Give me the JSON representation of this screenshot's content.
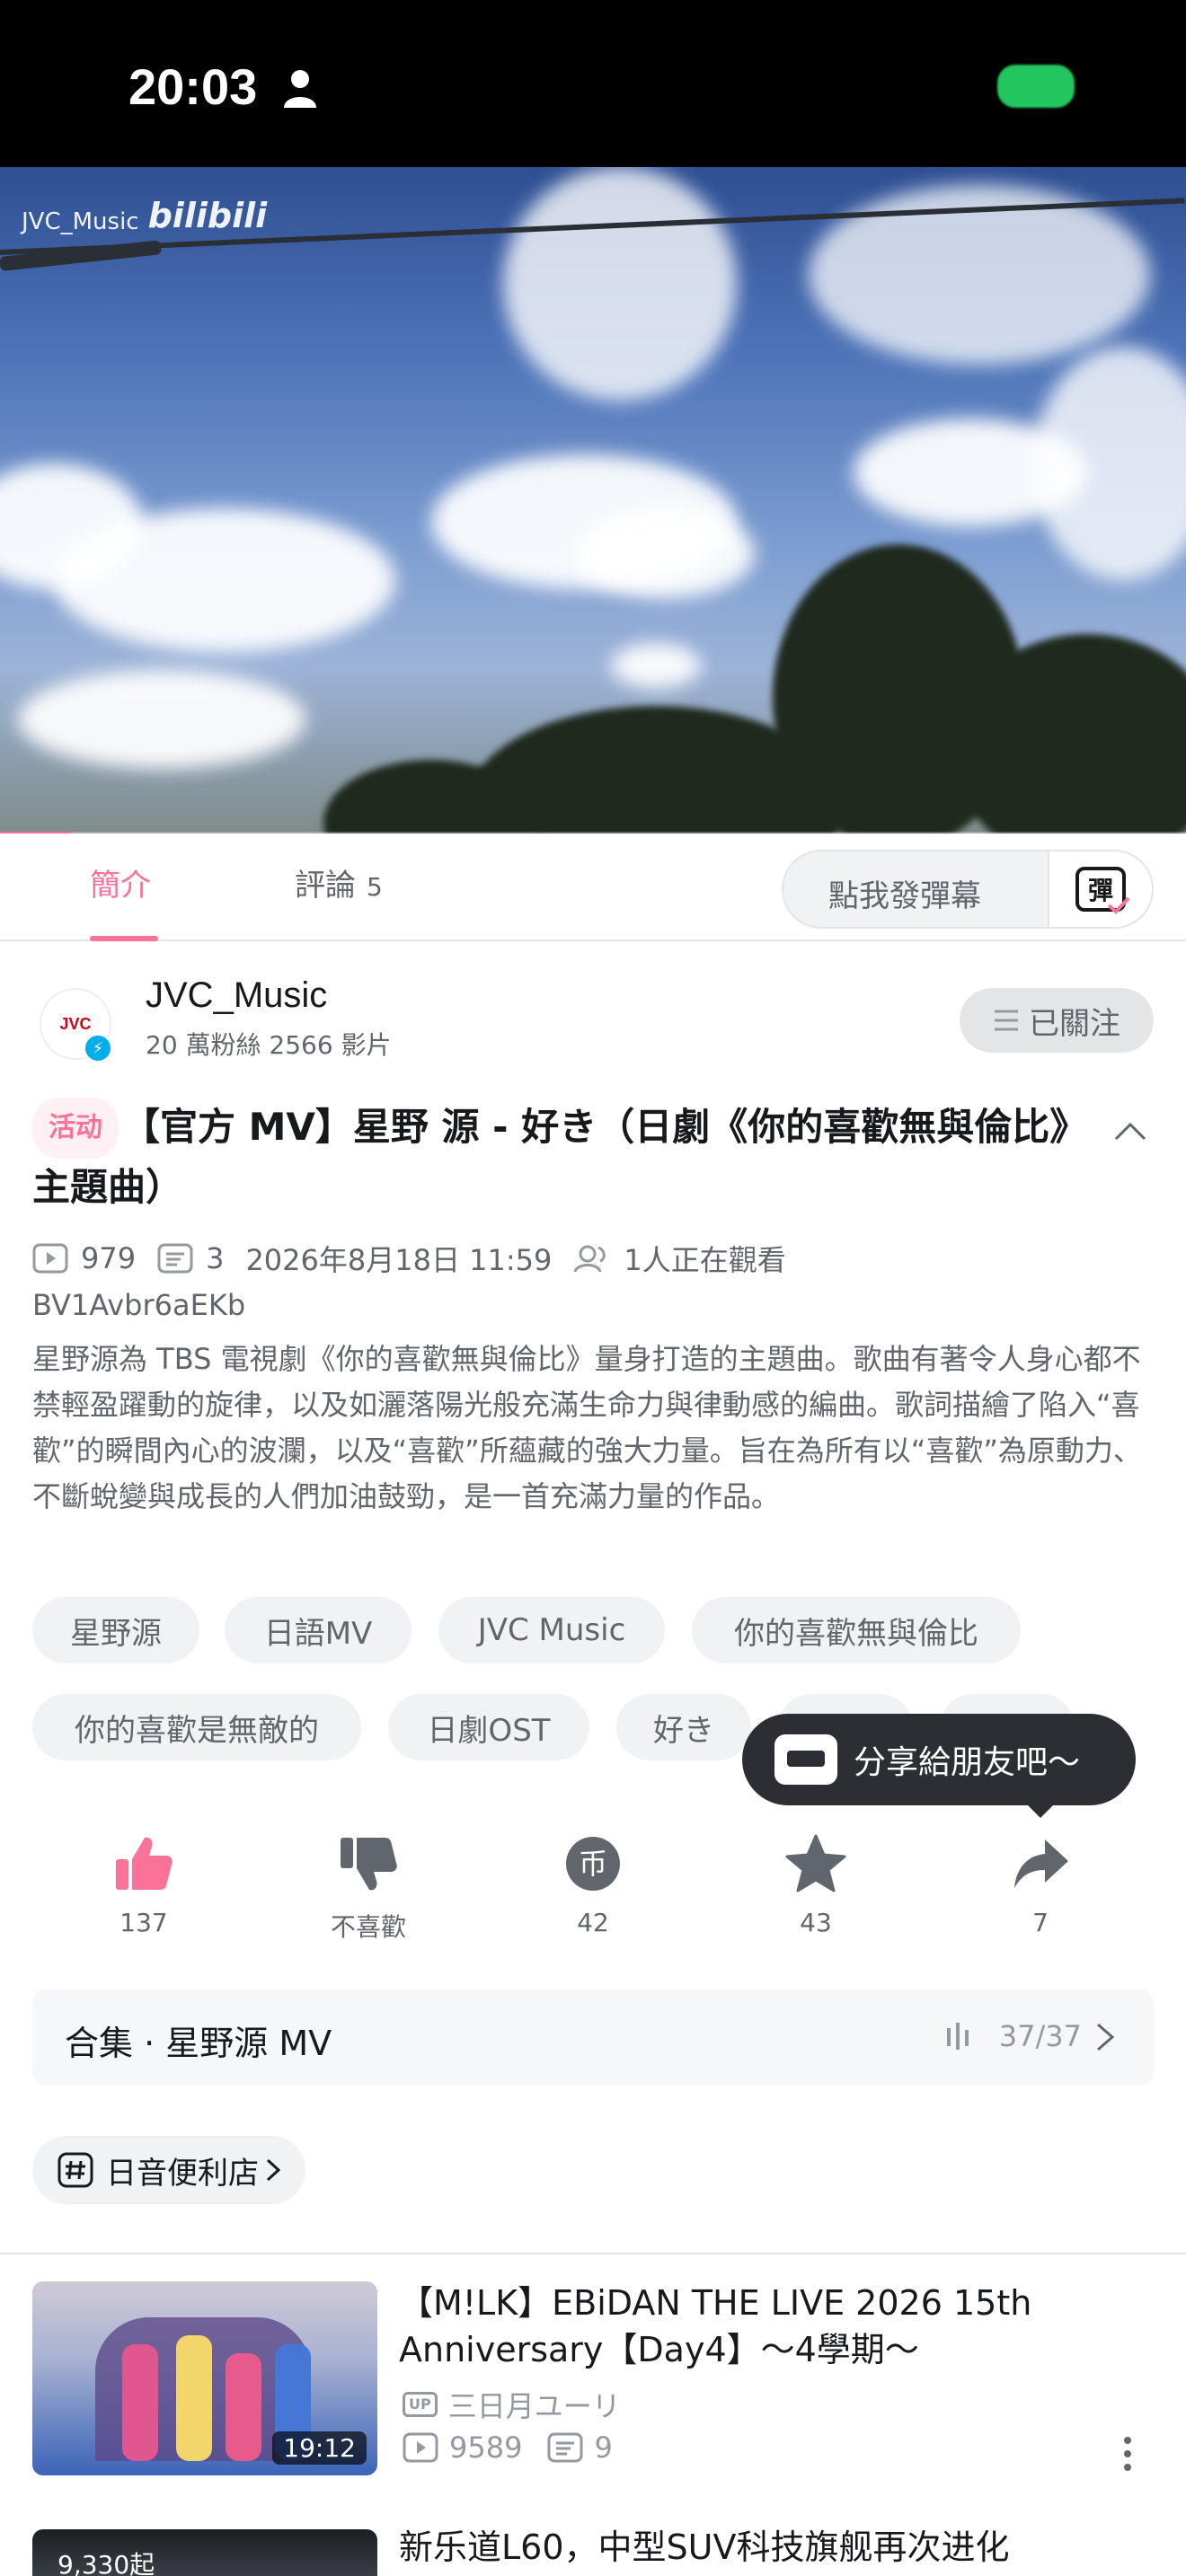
{
  "status_bar": {
    "time": "20:03"
  },
  "video": {
    "watermark_channel": "JVC_Music",
    "watermark_logo": "bilibili",
    "progress": 0.06
  },
  "tabs": {
    "intro_label": "簡介",
    "comments_label": "評論",
    "comments_count": "5",
    "danmaku_placeholder": "點我發彈幕",
    "danmaku_icon_char": "彈"
  },
  "uploader": {
    "avatar_text": "JVC",
    "name": "JVC_Music",
    "stats": "20 萬粉絲  2566 影片",
    "follow_label": "已關注"
  },
  "video_info": {
    "activity_tag": "活动",
    "title": "【官方 MV】星野 源 - 好き（日劇《你的喜歡無與倫比》主題曲）",
    "views": "979",
    "danmaku_count": "3",
    "date": "2026年8月18日 11:59",
    "watching": "1人正在觀看",
    "bvid": "BV1Avbr6aEKb",
    "description": "星野源為 TBS 電視劇《你的喜歡無與倫比》量身打造的主題曲。歌曲有著令人身心都不禁輕盈躍動的旋律，以及如灑落陽光般充滿生命力與律動感的編曲。歌詞描繪了陷入“喜歡”的瞬間內心的波瀾，以及“喜歡”所蘊藏的強大力量。旨在為所有以“喜歡”為原動力、不斷蛻變與成長的人們加油鼓勁，是一首充滿力量的作品。"
  },
  "tags": [
    "星野源",
    "日語MV",
    "JVC Music",
    "你的喜歡無與倫比",
    "你的喜歡是無敵的",
    "日劇OST",
    "好き",
    "Pop",
    "Suki"
  ],
  "share_bubble": {
    "text": "分享給朋友吧～"
  },
  "actions": {
    "like": "137",
    "dislike": "不喜歡",
    "coin": "42",
    "favorite": "43",
    "share": "7",
    "coin_glyph": "币"
  },
  "collection": {
    "title": "合集 · 星野源 MV",
    "count": "37/37"
  },
  "channel_chip": {
    "label": "日音便利店"
  },
  "related": [
    {
      "title": "【M!LK】EBiDAN THE LIVE 2026 15th Anniversary【Day4】～4學期～",
      "duration": "19:12",
      "uploader": "三日月ユーリ",
      "views": "9589",
      "danmaku": "9"
    },
    {
      "title": "新乐道L60，中型SUV科技旗舰再次进化",
      "overlay": "9,330起"
    }
  ],
  "colors": {
    "accent": "#fb7299",
    "text_primary": "#18191c",
    "text_secondary": "#61666d",
    "chip_bg": "#f1f2f3"
  }
}
